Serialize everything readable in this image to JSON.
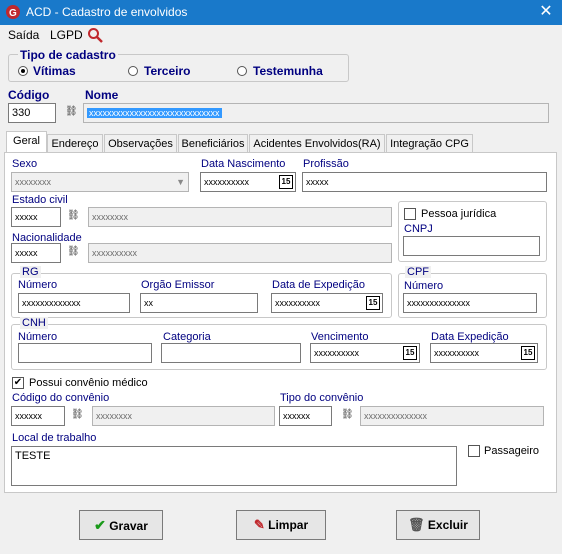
{
  "window": {
    "title": "ACD - Cadastro de envolvidos",
    "close_glyph": "✕"
  },
  "menu": {
    "item1": "Saída",
    "item2": "LGPD"
  },
  "tipo": {
    "title": "Tipo de cadastro",
    "opt1": "Vítimas",
    "opt2": "Terceiro",
    "opt3": "Testemunha",
    "selected": "Vítimas"
  },
  "header": {
    "codigo_label": "Código",
    "codigo_value": "330",
    "nome_label": "Nome",
    "nome_value": "xxxxxxxxxxxxxxxxxxxxxxxxxxxxx"
  },
  "tabs": [
    "Geral",
    "Endereço",
    "Observações",
    "Beneficiários",
    "Acidentes Envolvidos(RA)",
    "Integração CPG"
  ],
  "geral": {
    "sexo_label": "Sexo",
    "sexo_value": "xxxxxxxx",
    "nasc_label": "Data Nascimento",
    "nasc_value": "xxxxxxxxxx",
    "profissao_label": "Profissão",
    "profissao_value": "xxxxx",
    "estado_civil_label": "Estado civil",
    "estado_civil_code": "xxxxx",
    "estado_civil_desc": "xxxxxxxx",
    "pj_label": "Pessoa jurídica",
    "cnpj_label": "CNPJ",
    "cnpj_value": "",
    "nacionalidade_label": "Nacionalidade",
    "nacionalidade_code": "xxxxx",
    "nacionalidade_desc": "xxxxxxxxxx",
    "rg_title": "RG",
    "rg_numero_label": "Número",
    "rg_numero_value": "xxxxxxxxxxxxx",
    "rg_orgao_label": "Orgão Emissor",
    "rg_orgao_value": "xx",
    "rg_exp_label": "Data de Expedição",
    "rg_exp_value": "xxxxxxxxxx",
    "cpf_title": "CPF",
    "cpf_numero_label": "Número",
    "cpf_numero_value": "xxxxxxxxxxxxxx",
    "cnh_title": "CNH",
    "cnh_numero_label": "Número",
    "cnh_numero_value": "",
    "cnh_categoria_label": "Categoria",
    "cnh_categoria_value": "",
    "cnh_venc_label": "Vencimento",
    "cnh_venc_value": "xxxxxxxxxx",
    "cnh_exp_label": "Data Expedição",
    "cnh_exp_value": "xxxxxxxxxx",
    "convenio_label": "Possui convênio médico",
    "cod_convenio_label": "Código do convênio",
    "cod_convenio_value": "xxxxxx",
    "cod_convenio_desc": "xxxxxxxx",
    "tipo_convenio_label": "Tipo do convênio",
    "tipo_convenio_value": "xxxxxx",
    "tipo_convenio_desc": "xxxxxxxxxxxxxx",
    "local_label": "Local de trabalho",
    "local_value": "TESTE",
    "passageiro_label": "Passageiro",
    "cal_glyph": "15"
  },
  "buttons": {
    "gravar": "Gravar",
    "limpar": "Limpar",
    "excluir": "Excluir"
  },
  "colors": {
    "titlebar": "#1979ca",
    "selection": "#3399ff",
    "gravar_icon": "#1a9a1a"
  }
}
